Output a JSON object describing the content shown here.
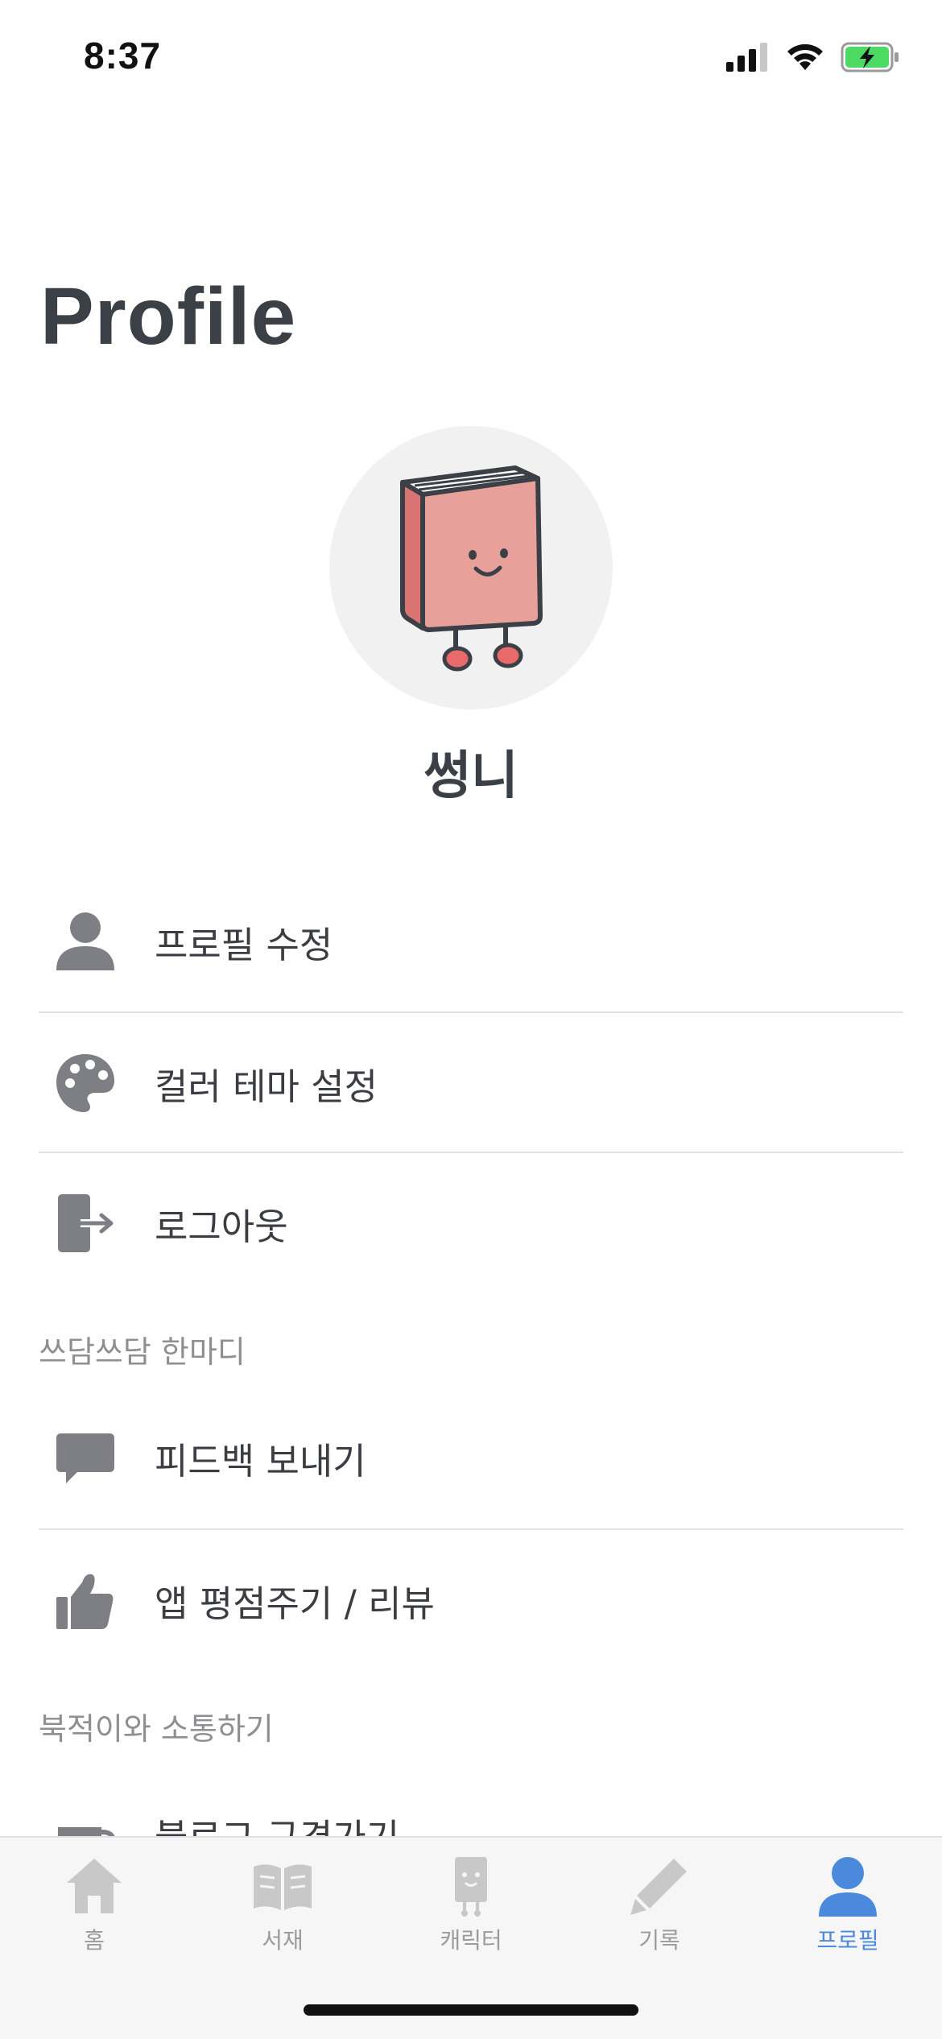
{
  "status_bar": {
    "time": "8:37"
  },
  "page": {
    "title": "Profile"
  },
  "profile": {
    "name": "썽니"
  },
  "menu": {
    "edit_profile": "프로필 수정",
    "color_theme": "컬러 테마 설정",
    "logout": "로그아웃"
  },
  "sections": {
    "feedback": {
      "header": "쓰담쓰담 한마디",
      "send_feedback": "피드백 보내기",
      "rate_app": "앱 평점주기 / 리뷰"
    },
    "community": {
      "header": "북적이와 소통하기",
      "blog": "블로그 구경가기"
    }
  },
  "tab_bar": {
    "tabs": [
      {
        "label": "홈",
        "icon": "home-icon"
      },
      {
        "label": "서재",
        "icon": "book-open-icon"
      },
      {
        "label": "캐릭터",
        "icon": "character-icon"
      },
      {
        "label": "기록",
        "icon": "pencil-icon"
      },
      {
        "label": "프로필",
        "icon": "person-icon"
      }
    ],
    "active_index": 4
  },
  "colors": {
    "accent": "#4a89dc",
    "icon_gray": "#7d7f85",
    "tab_inactive": "#c8c8c8",
    "character_pink": "#e8a09b"
  }
}
